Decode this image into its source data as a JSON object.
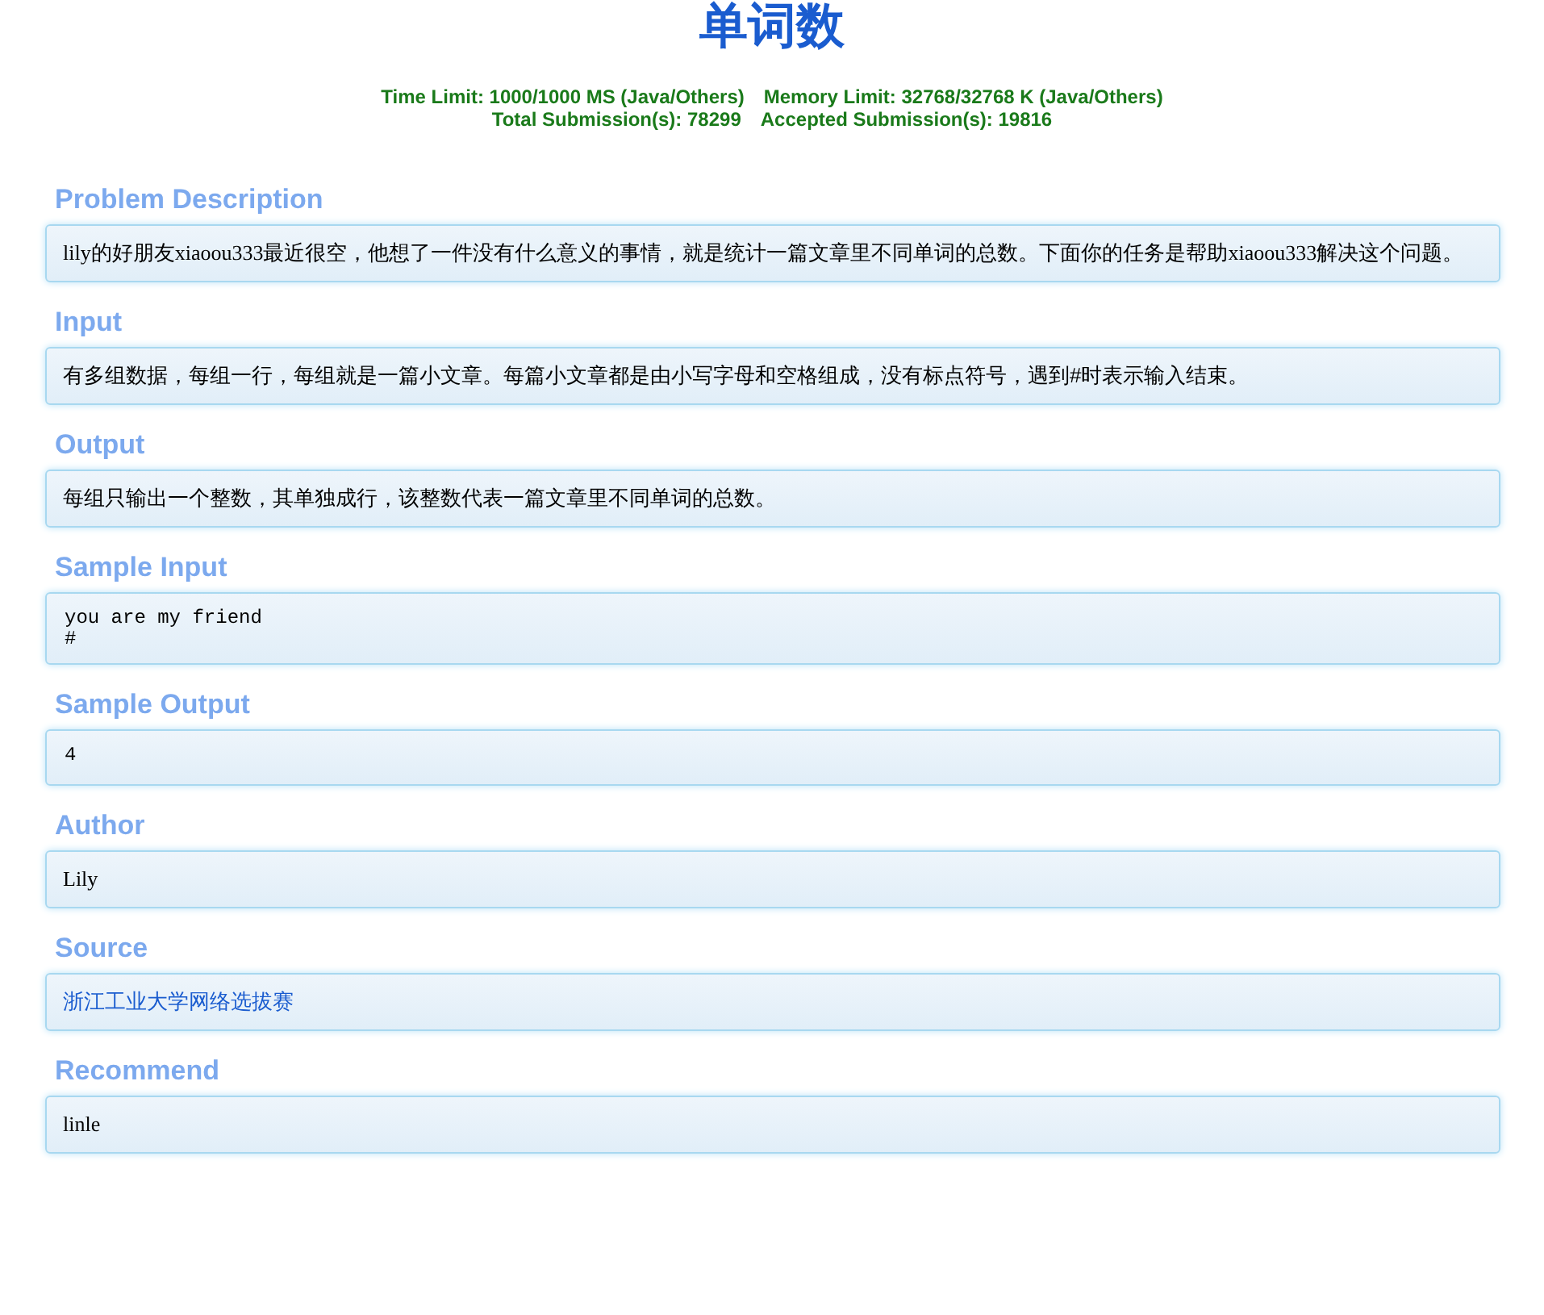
{
  "title": "单词数",
  "limits": {
    "time_limit": "Time Limit: 1000/1000 MS (Java/Others)",
    "memory_limit": "Memory Limit: 32768/32768 K (Java/Others)",
    "total_submissions": "Total Submission(s): 78299",
    "accepted_submissions": "Accepted Submission(s): 19816"
  },
  "sections": [
    {
      "heading": "Problem Description",
      "kind": "serif",
      "content": "lily的好朋友xiaoou333最近很空，他想了一件没有什么意义的事情，就是统计一篇文章里不同单词的总数。下面你的任务是帮助xiaoou333解决这个问题。"
    },
    {
      "heading": "Input",
      "kind": "text",
      "content": "有多组数据，每组一行，每组就是一篇小文章。每篇小文章都是由小写字母和空格组成，没有标点符号，遇到#时表示输入结束。"
    },
    {
      "heading": "Output",
      "kind": "text",
      "content": "每组只输出一个整数，其单独成行，该整数代表一篇文章里不同单词的总数。"
    },
    {
      "heading": "Sample Input",
      "kind": "code",
      "content": "you are my friend\n#"
    },
    {
      "heading": "Sample Output",
      "kind": "code",
      "content": "4"
    },
    {
      "heading": "Author",
      "kind": "serif",
      "content": "Lily"
    },
    {
      "heading": "Source",
      "kind": "link",
      "content": "浙江工业大学网络选拔赛"
    },
    {
      "heading": "Recommend",
      "kind": "serif",
      "content": "linle"
    }
  ]
}
